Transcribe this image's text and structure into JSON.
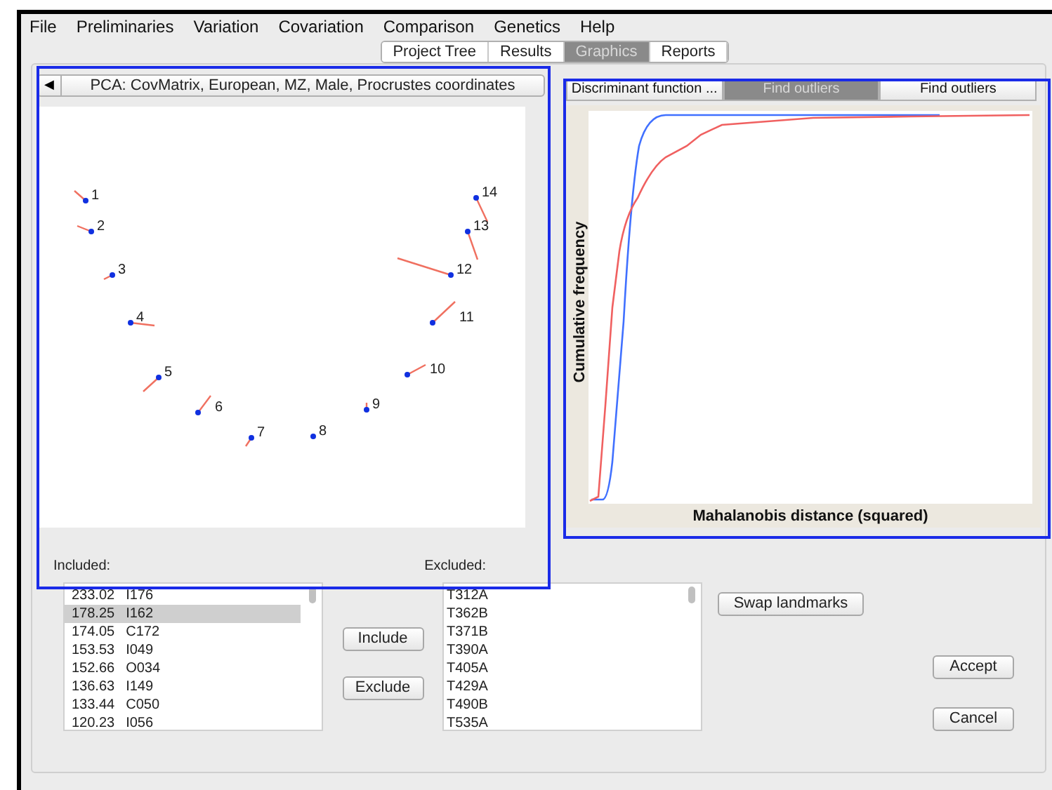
{
  "menu": [
    "File",
    "Preliminaries",
    "Variation",
    "Covariation",
    "Comparison",
    "Genetics",
    "Help"
  ],
  "main_tabs": [
    {
      "label": "Project Tree",
      "selected": false
    },
    {
      "label": "Results",
      "selected": false
    },
    {
      "label": "Graphics",
      "selected": true
    },
    {
      "label": "Reports",
      "selected": false
    }
  ],
  "left_panel": {
    "selector": {
      "arrow": "◀",
      "label": "PCA: CovMatrix, European, MZ, Male, Procrustes coordinates"
    },
    "landmarks": [
      "1",
      "2",
      "3",
      "4",
      "5",
      "6",
      "7",
      "8",
      "9",
      "10",
      "11",
      "12",
      "13",
      "14"
    ],
    "included_label": "Included:",
    "excluded_label": "Excluded:"
  },
  "right_panel": {
    "tabs": [
      {
        "label": "Discriminant function ...",
        "selected": false
      },
      {
        "label": "Find outliers",
        "selected": true
      },
      {
        "label": "Find outliers",
        "selected": false
      }
    ],
    "plot": {
      "ylabel": "Cumulative frequency",
      "xlabel": "Mahalanobis distance (squared)"
    }
  },
  "included_list": [
    {
      "score": "233.02",
      "id": "I176",
      "selected": false
    },
    {
      "score": "178.25",
      "id": "I162",
      "selected": true
    },
    {
      "score": "174.05",
      "id": "C172",
      "selected": false
    },
    {
      "score": "153.53",
      "id": "I049",
      "selected": false
    },
    {
      "score": "152.66",
      "id": "O034",
      "selected": false
    },
    {
      "score": "136.63",
      "id": "I149",
      "selected": false
    },
    {
      "score": "133.44",
      "id": "C050",
      "selected": false
    },
    {
      "score": "120.23",
      "id": "I056",
      "selected": false
    }
  ],
  "excluded_list": [
    "T312A",
    "T362B",
    "T371B",
    "T390A",
    "T405A",
    "T429A",
    "T490B",
    "T535A"
  ],
  "include_button": "Include",
  "exclude_button": "Exclude",
  "swap_button": "Swap landmarks",
  "accept_button": "Accept",
  "cancel_button": "Cancel"
}
